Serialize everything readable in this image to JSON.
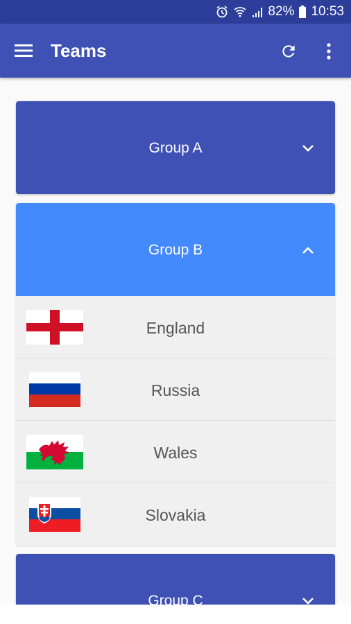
{
  "status_bar": {
    "battery": "82%",
    "time": "10:53",
    "icons": [
      "alarm-icon",
      "wifi-icon",
      "signal-icon",
      "battery-icon"
    ]
  },
  "app_bar": {
    "title": "Teams",
    "icons": [
      "menu-icon",
      "refresh-icon",
      "more-vert-icon"
    ]
  },
  "colors": {
    "app_bar": "#3f51b5",
    "status_bar": "#2c3e99",
    "group_collapsed": "#3f51b5",
    "group_expanded": "#448aff",
    "team_list_bg": "#f0f0f0"
  },
  "groups": [
    {
      "label": "Group A",
      "state": "collapsed"
    },
    {
      "label": "Group B",
      "state": "expanded"
    },
    {
      "label": "Group C",
      "state": "collapsed"
    }
  ],
  "teams": [
    {
      "name": "England",
      "flag": "england-flag-icon"
    },
    {
      "name": "Russia",
      "flag": "russia-flag-icon"
    },
    {
      "name": "Wales",
      "flag": "wales-flag-icon"
    },
    {
      "name": "Slovakia",
      "flag": "slovakia-flag-icon"
    }
  ]
}
